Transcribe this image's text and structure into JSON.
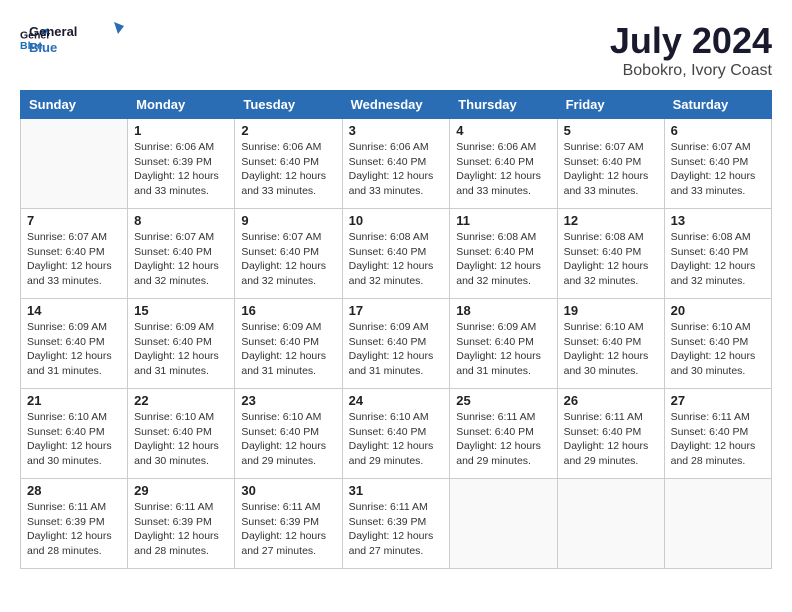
{
  "logo": {
    "line1": "General",
    "line2": "Blue"
  },
  "header": {
    "month_year": "July 2024",
    "location": "Bobokro, Ivory Coast"
  },
  "days_of_week": [
    "Sunday",
    "Monday",
    "Tuesday",
    "Wednesday",
    "Thursday",
    "Friday",
    "Saturday"
  ],
  "weeks": [
    [
      {
        "day": "",
        "info": ""
      },
      {
        "day": "1",
        "info": "Sunrise: 6:06 AM\nSunset: 6:39 PM\nDaylight: 12 hours\nand 33 minutes."
      },
      {
        "day": "2",
        "info": "Sunrise: 6:06 AM\nSunset: 6:40 PM\nDaylight: 12 hours\nand 33 minutes."
      },
      {
        "day": "3",
        "info": "Sunrise: 6:06 AM\nSunset: 6:40 PM\nDaylight: 12 hours\nand 33 minutes."
      },
      {
        "day": "4",
        "info": "Sunrise: 6:06 AM\nSunset: 6:40 PM\nDaylight: 12 hours\nand 33 minutes."
      },
      {
        "day": "5",
        "info": "Sunrise: 6:07 AM\nSunset: 6:40 PM\nDaylight: 12 hours\nand 33 minutes."
      },
      {
        "day": "6",
        "info": "Sunrise: 6:07 AM\nSunset: 6:40 PM\nDaylight: 12 hours\nand 33 minutes."
      }
    ],
    [
      {
        "day": "7",
        "info": ""
      },
      {
        "day": "8",
        "info": "Sunrise: 6:07 AM\nSunset: 6:40 PM\nDaylight: 12 hours\nand 32 minutes."
      },
      {
        "day": "9",
        "info": "Sunrise: 6:07 AM\nSunset: 6:40 PM\nDaylight: 12 hours\nand 32 minutes."
      },
      {
        "day": "10",
        "info": "Sunrise: 6:08 AM\nSunset: 6:40 PM\nDaylight: 12 hours\nand 32 minutes."
      },
      {
        "day": "11",
        "info": "Sunrise: 6:08 AM\nSunset: 6:40 PM\nDaylight: 12 hours\nand 32 minutes."
      },
      {
        "day": "12",
        "info": "Sunrise: 6:08 AM\nSunset: 6:40 PM\nDaylight: 12 hours\nand 32 minutes."
      },
      {
        "day": "13",
        "info": "Sunrise: 6:08 AM\nSunset: 6:40 PM\nDaylight: 12 hours\nand 32 minutes."
      }
    ],
    [
      {
        "day": "14",
        "info": ""
      },
      {
        "day": "15",
        "info": "Sunrise: 6:09 AM\nSunset: 6:40 PM\nDaylight: 12 hours\nand 31 minutes."
      },
      {
        "day": "16",
        "info": "Sunrise: 6:09 AM\nSunset: 6:40 PM\nDaylight: 12 hours\nand 31 minutes."
      },
      {
        "day": "17",
        "info": "Sunrise: 6:09 AM\nSunset: 6:40 PM\nDaylight: 12 hours\nand 31 minutes."
      },
      {
        "day": "18",
        "info": "Sunrise: 6:09 AM\nSunset: 6:40 PM\nDaylight: 12 hours\nand 31 minutes."
      },
      {
        "day": "19",
        "info": "Sunrise: 6:10 AM\nSunset: 6:40 PM\nDaylight: 12 hours\nand 30 minutes."
      },
      {
        "day": "20",
        "info": "Sunrise: 6:10 AM\nSunset: 6:40 PM\nDaylight: 12 hours\nand 30 minutes."
      }
    ],
    [
      {
        "day": "21",
        "info": ""
      },
      {
        "day": "22",
        "info": "Sunrise: 6:10 AM\nSunset: 6:40 PM\nDaylight: 12 hours\nand 30 minutes."
      },
      {
        "day": "23",
        "info": "Sunrise: 6:10 AM\nSunset: 6:40 PM\nDaylight: 12 hours\nand 29 minutes."
      },
      {
        "day": "24",
        "info": "Sunrise: 6:10 AM\nSunset: 6:40 PM\nDaylight: 12 hours\nand 29 minutes."
      },
      {
        "day": "25",
        "info": "Sunrise: 6:11 AM\nSunset: 6:40 PM\nDaylight: 12 hours\nand 29 minutes."
      },
      {
        "day": "26",
        "info": "Sunrise: 6:11 AM\nSunset: 6:40 PM\nDaylight: 12 hours\nand 29 minutes."
      },
      {
        "day": "27",
        "info": "Sunrise: 6:11 AM\nSunset: 6:40 PM\nDaylight: 12 hours\nand 28 minutes."
      }
    ],
    [
      {
        "day": "28",
        "info": "Sunrise: 6:11 AM\nSunset: 6:39 PM\nDaylight: 12 hours\nand 28 minutes."
      },
      {
        "day": "29",
        "info": "Sunrise: 6:11 AM\nSunset: 6:39 PM\nDaylight: 12 hours\nand 28 minutes."
      },
      {
        "day": "30",
        "info": "Sunrise: 6:11 AM\nSunset: 6:39 PM\nDaylight: 12 hours\nand 27 minutes."
      },
      {
        "day": "31",
        "info": "Sunrise: 6:11 AM\nSunset: 6:39 PM\nDaylight: 12 hours\nand 27 minutes."
      },
      {
        "day": "",
        "info": ""
      },
      {
        "day": "",
        "info": ""
      },
      {
        "day": "",
        "info": ""
      }
    ]
  ],
  "week1_day7_info": "Sunrise: 6:07 AM\nSunset: 6:40 PM\nDaylight: 12 hours\nand 33 minutes.",
  "week2_day7_sun": "Sunrise: 6:07 AM\nSunset: 6:40 PM\nDaylight: 12 hours\nand 33 minutes.",
  "week3_day14_info": "Sunrise: 6:09 AM\nSunset: 6:40 PM\nDaylight: 12 hours\nand 31 minutes.",
  "week4_day21_info": "Sunrise: 6:10 AM\nSunset: 6:40 PM\nDaylight: 12 hours\nand 30 minutes."
}
